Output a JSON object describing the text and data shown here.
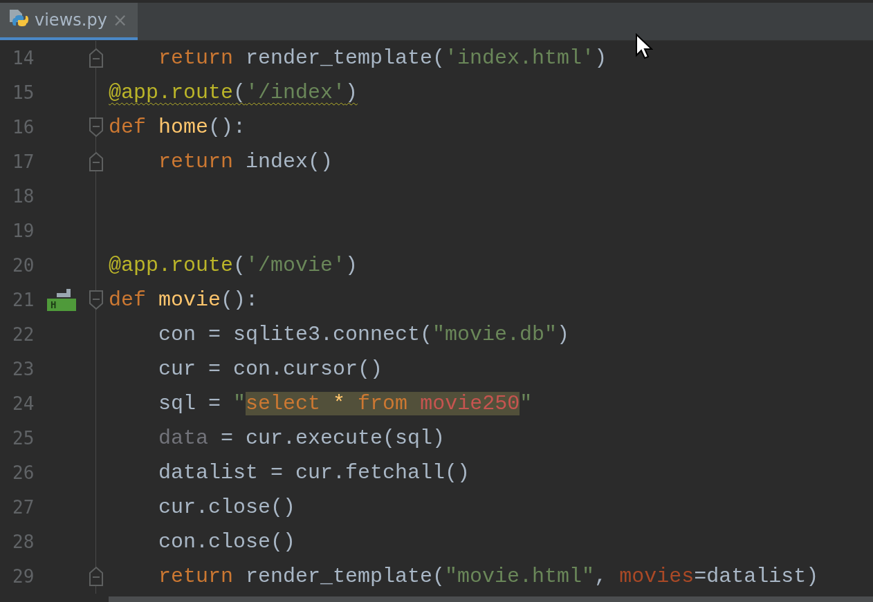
{
  "tabs": [
    {
      "label": "views.py",
      "selected": true,
      "close": "×"
    }
  ],
  "lines": [
    {
      "number": "14",
      "fold_end": true,
      "indented": true,
      "tokens": [
        {
          "kind": "keyword",
          "text": "return"
        },
        {
          "kind": "plain",
          "text": "render_template(",
          "spaced": true
        },
        {
          "kind": "string",
          "text": "'index.html'"
        },
        {
          "kind": "plain",
          "text": ")"
        }
      ]
    },
    {
      "number": "15",
      "warning": true,
      "tokens": [
        {
          "kind": "decorator",
          "text": "@app.route"
        },
        {
          "kind": "plain",
          "text": "("
        },
        {
          "kind": "string",
          "text": "'/index'"
        },
        {
          "kind": "plain",
          "text": ")"
        }
      ]
    },
    {
      "number": "16",
      "fold_start": true,
      "tokens": [
        {
          "kind": "keyword",
          "text": "def"
        },
        {
          "kind": "function",
          "text": "home",
          "spaced": true
        },
        {
          "kind": "plain",
          "text": "():"
        }
      ]
    },
    {
      "number": "17",
      "fold_end": true,
      "indented": true,
      "tokens": [
        {
          "kind": "keyword",
          "text": "return"
        },
        {
          "kind": "plain",
          "text": "index()",
          "spaced": true
        }
      ]
    },
    {
      "number": "18"
    },
    {
      "number": "19"
    },
    {
      "number": "20",
      "tokens": [
        {
          "kind": "decorator",
          "text": "@app.route"
        },
        {
          "kind": "plain",
          "text": "("
        },
        {
          "kind": "string",
          "text": "'/movie'"
        },
        {
          "kind": "plain",
          "text": ")"
        }
      ]
    },
    {
      "number": "21",
      "fold_start": true,
      "badge": "H",
      "tokens": [
        {
          "kind": "keyword",
          "text": "def"
        },
        {
          "kind": "function",
          "text": "movie",
          "spaced": true
        },
        {
          "kind": "plain",
          "text": "():"
        }
      ]
    },
    {
      "number": "22",
      "indented": true,
      "tokens": [
        {
          "kind": "plain",
          "text": "con = sqlite3.connect("
        },
        {
          "kind": "string",
          "text": "\"movie.db\""
        },
        {
          "kind": "plain",
          "text": ")"
        }
      ]
    },
    {
      "number": "23",
      "indented": true,
      "tokens": [
        {
          "kind": "plain",
          "text": "cur = con.cursor()"
        }
      ]
    },
    {
      "number": "24",
      "indented": true,
      "tokens": [
        {
          "kind": "plain",
          "text": "sql = "
        },
        {
          "kind": "string",
          "text": "\""
        },
        {
          "kind": "sql_keyword",
          "text": "select ",
          "highlighted": true
        },
        {
          "kind": "sql_star",
          "text": "*",
          "highlighted": true
        },
        {
          "kind": "sql_keyword",
          "text": " from ",
          "highlighted": true
        },
        {
          "kind": "sql_table",
          "text": "movie250",
          "highlighted": true
        },
        {
          "kind": "string",
          "text": "\""
        }
      ]
    },
    {
      "number": "25",
      "indented": true,
      "tokens": [
        {
          "kind": "unused",
          "text": "data"
        },
        {
          "kind": "plain",
          "text": "= cur.execute(sql)",
          "spaced": true
        }
      ]
    },
    {
      "number": "26",
      "indented": true,
      "tokens": [
        {
          "kind": "plain",
          "text": "datalist = cur.fetchall()"
        }
      ]
    },
    {
      "number": "27",
      "indented": true,
      "tokens": [
        {
          "kind": "plain",
          "text": "cur.close()"
        }
      ]
    },
    {
      "number": "28",
      "indented": true,
      "tokens": [
        {
          "kind": "plain",
          "text": "con.close()"
        }
      ]
    },
    {
      "number": "29",
      "fold_end": true,
      "indented": true,
      "tokens": [
        {
          "kind": "keyword",
          "text": "return"
        },
        {
          "kind": "plain",
          "text": "render_template(",
          "spaced": true
        },
        {
          "kind": "string",
          "text": "\"movie.html\""
        },
        {
          "kind": "plain",
          "text": ","
        },
        {
          "kind": "param",
          "text": "movies",
          "spaced": true
        },
        {
          "kind": "plain",
          "text": "=datalist)"
        }
      ]
    }
  ]
}
